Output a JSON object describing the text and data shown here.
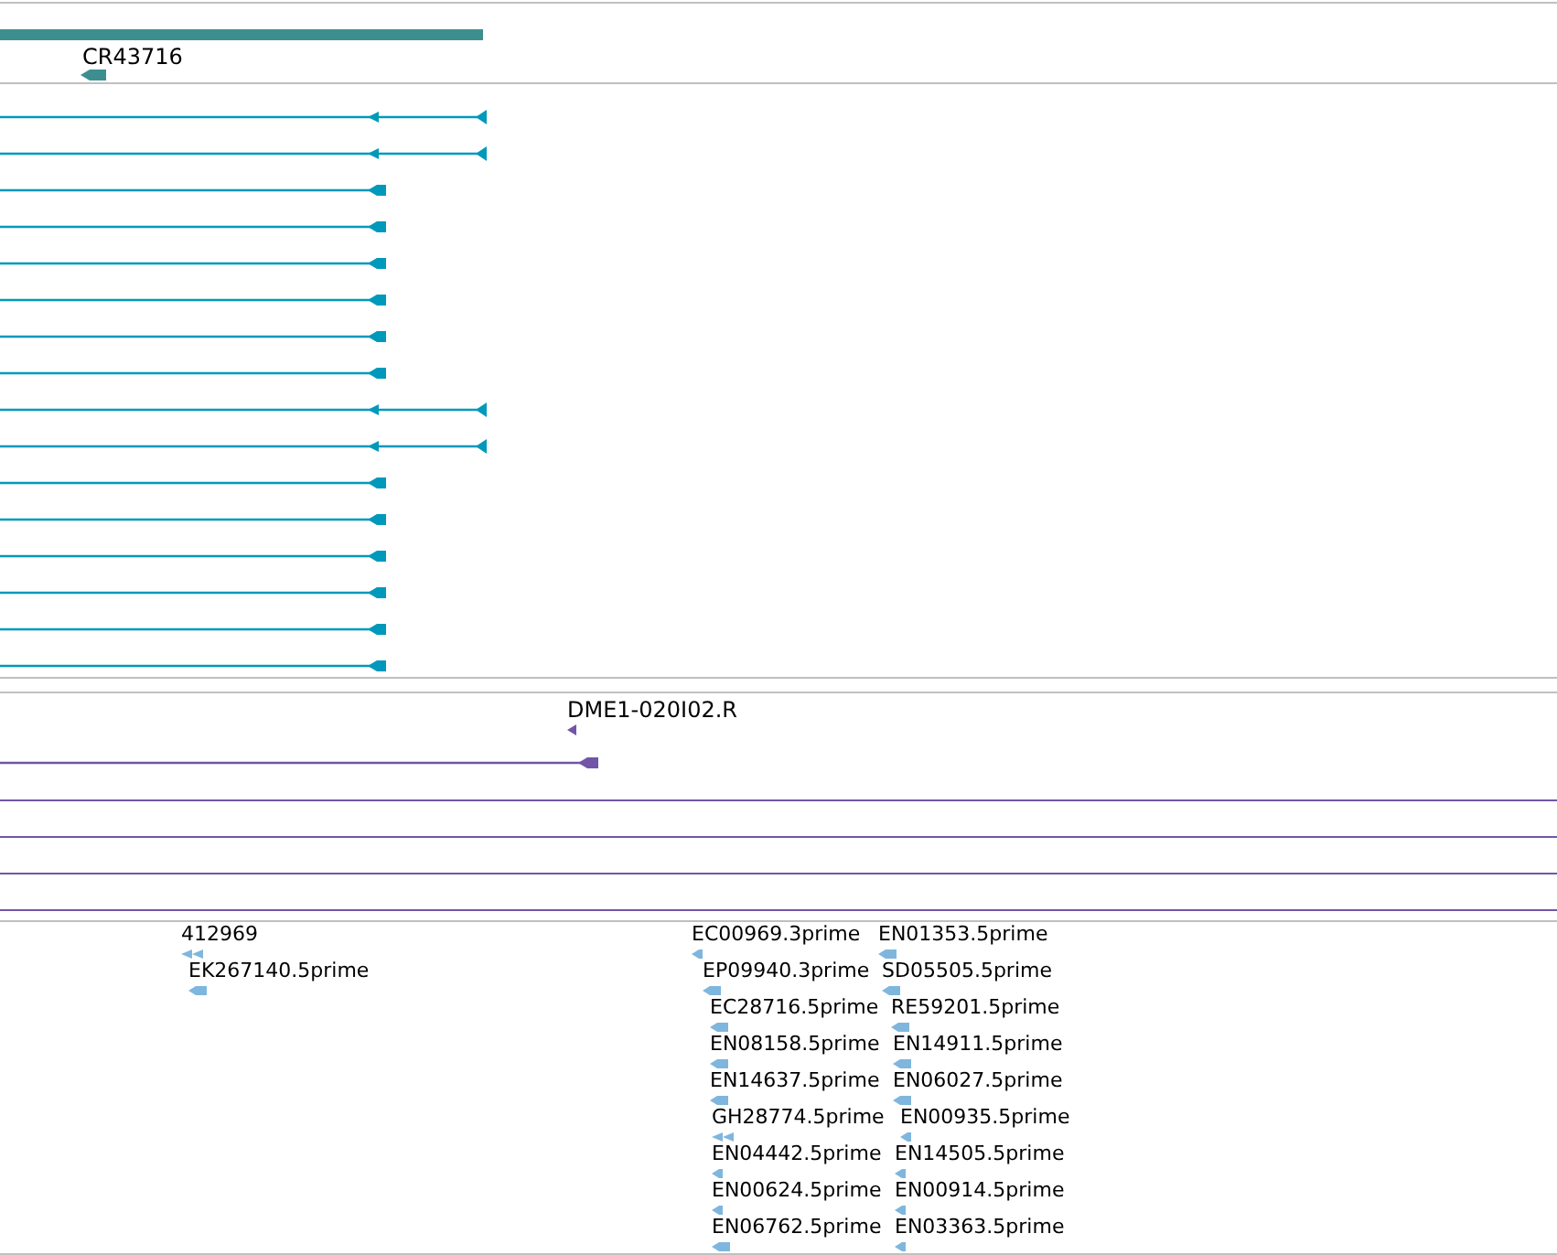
{
  "gene_track": {
    "features": [
      {
        "label": "CR43716"
      }
    ]
  },
  "transcript_track": {
    "rows": [
      {
        "kind": "double"
      },
      {
        "kind": "double"
      },
      {
        "kind": "single"
      },
      {
        "kind": "single"
      },
      {
        "kind": "single"
      },
      {
        "kind": "single"
      },
      {
        "kind": "single"
      },
      {
        "kind": "single"
      },
      {
        "kind": "double"
      },
      {
        "kind": "double"
      },
      {
        "kind": "single"
      },
      {
        "kind": "single"
      },
      {
        "kind": "single"
      },
      {
        "kind": "single"
      },
      {
        "kind": "single"
      },
      {
        "kind": "single"
      }
    ]
  },
  "clone_track": {
    "features": [
      {
        "label": "DME1-020I02.R"
      }
    ]
  },
  "est_track": {
    "features": [
      {
        "label": "412969"
      },
      {
        "label": "EK267140.5prime"
      },
      {
        "label": "EC00969.3prime"
      },
      {
        "label": "EP09940.3prime"
      },
      {
        "label": "EC28716.5prime"
      },
      {
        "label": "EN08158.5prime"
      },
      {
        "label": "EN14637.5prime"
      },
      {
        "label": "GH28774.5prime"
      },
      {
        "label": "EN04442.5prime"
      },
      {
        "label": "EN00624.5prime"
      },
      {
        "label": "EN06762.5prime"
      },
      {
        "label": "EN01353.5prime"
      },
      {
        "label": "SD05505.5prime"
      },
      {
        "label": "RE59201.5prime"
      },
      {
        "label": "EN14911.5prime"
      },
      {
        "label": "EN06027.5prime"
      },
      {
        "label": "EN00935.5prime"
      },
      {
        "label": "EN14505.5prime"
      },
      {
        "label": "EN00914.5prime"
      },
      {
        "label": "EN03363.5prime"
      }
    ]
  }
}
